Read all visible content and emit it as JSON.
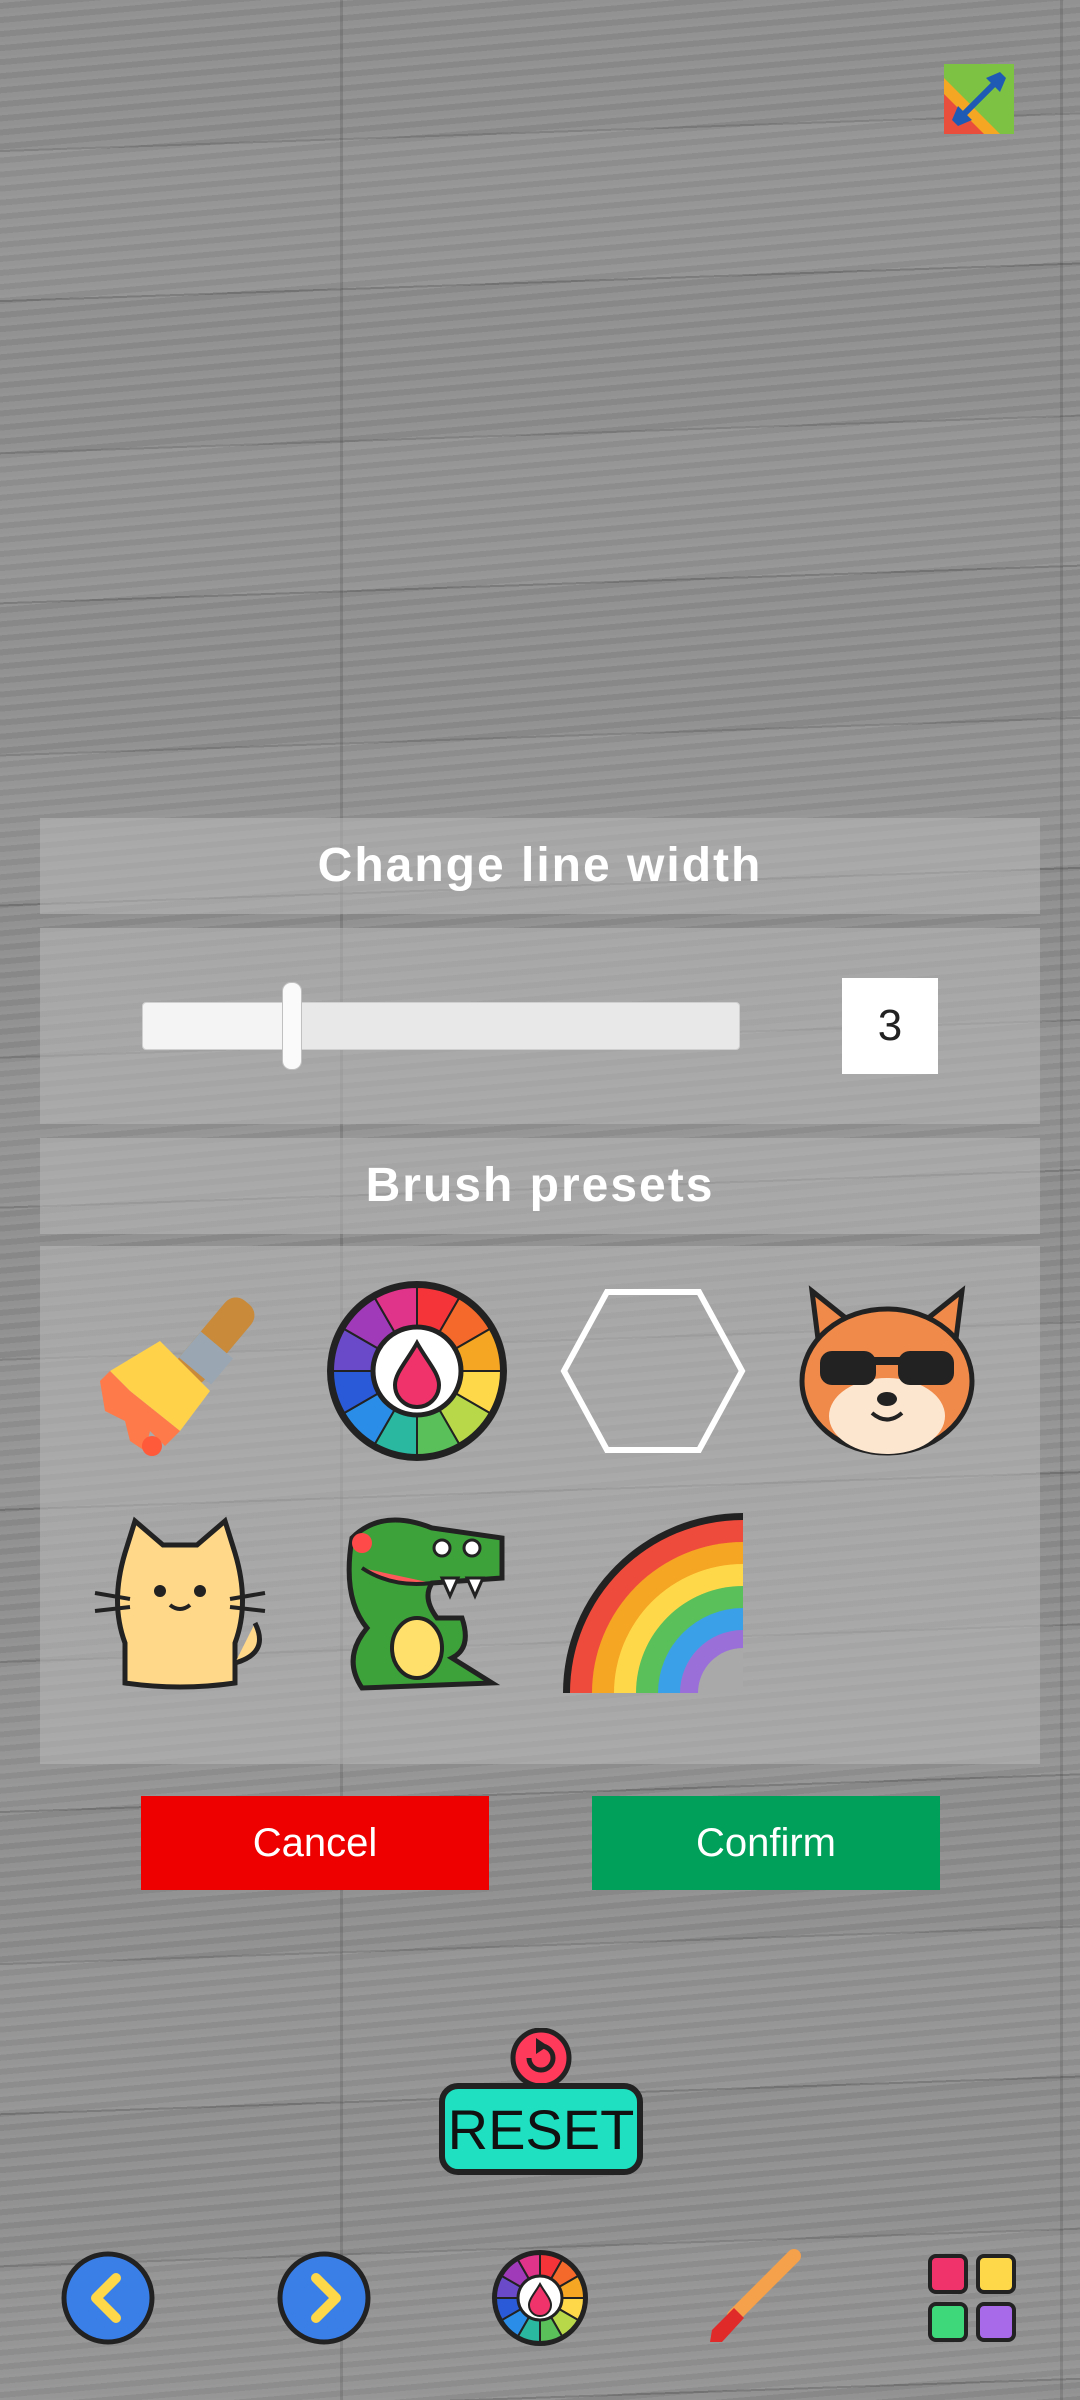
{
  "dialog": {
    "line_width_title": "Change line width",
    "line_width_value": "3",
    "slider": {
      "min": 0,
      "max": 12,
      "value": 3
    },
    "presets_title": "Brush presets",
    "presets": [
      {
        "name": "paint-brush"
      },
      {
        "name": "color-wheel"
      },
      {
        "name": "hexagon"
      },
      {
        "name": "shiba-sunglasses"
      },
      {
        "name": "cat"
      },
      {
        "name": "crocodile"
      },
      {
        "name": "rainbow"
      }
    ],
    "cancel_label": "Cancel",
    "confirm_label": "Confirm"
  },
  "reset": {
    "label": "RESET"
  },
  "colors": {
    "cancel": "#ee0000",
    "confirm": "#00a05a",
    "reset_teal": "#1fe0c0",
    "nav_blue": "#3a7ee8"
  },
  "icons": [
    "resize-icon",
    "back-icon",
    "forward-icon",
    "color-wheel-icon",
    "brush-icon",
    "grid-icon"
  ]
}
